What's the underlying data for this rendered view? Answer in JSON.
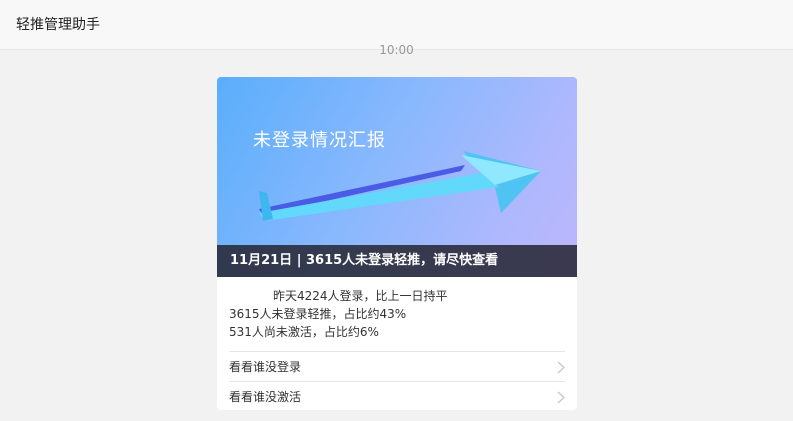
{
  "header": {
    "title": "轻推管理助手"
  },
  "timestamp": "10:00",
  "card": {
    "banner_title": "未登录情况汇报",
    "caption": "11月21日 | 3615人未登录轻推，请尽快查看",
    "summary": [
      "昨天4224人登录，比上一日持平",
      "3615人未登录轻推，占比约43%",
      "531人尚未激活，占比约6%"
    ],
    "links": [
      {
        "label": "看看谁没登录"
      },
      {
        "label": "看看谁没激活"
      }
    ]
  },
  "colors": {
    "banner_gradient": [
      "#5aaefc",
      "#bcb6fb"
    ],
    "arrow": "#62d9fb",
    "arrow_shadow": "#4a5be6"
  }
}
